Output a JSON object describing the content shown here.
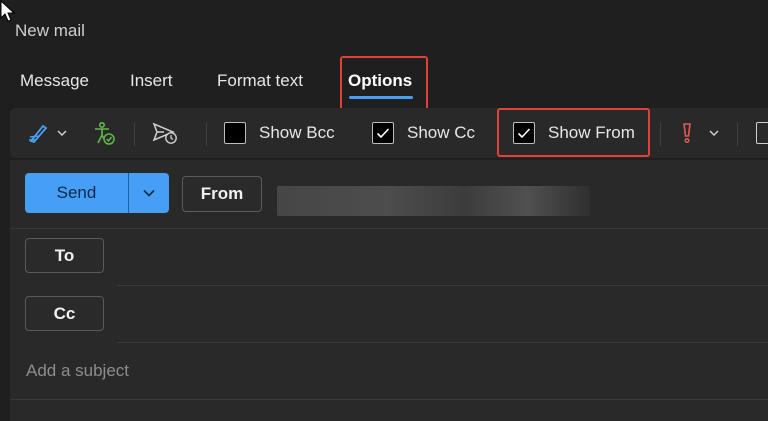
{
  "window": {
    "title": "New mail"
  },
  "tabs": [
    {
      "label": "Message"
    },
    {
      "label": "Insert"
    },
    {
      "label": "Format text"
    },
    {
      "label": "Options",
      "active": true
    }
  ],
  "toolbar": {
    "icons": [
      "signature-icon",
      "accessibility-checker-icon",
      "schedule-send-icon",
      "importance-icon"
    ],
    "show_bcc": {
      "label": "Show Bcc",
      "checked": false
    },
    "show_cc": {
      "label": "Show Cc",
      "checked": true
    },
    "show_from": {
      "label": "Show From",
      "checked": true
    }
  },
  "compose": {
    "send_label": "Send",
    "from_label": "From",
    "to_label": "To",
    "cc_label": "Cc",
    "subject_placeholder": "Add a subject"
  },
  "colors": {
    "accent": "#479ef5",
    "highlight": "#e0413a",
    "background": "#1f1f1f",
    "surface": "#292929"
  }
}
